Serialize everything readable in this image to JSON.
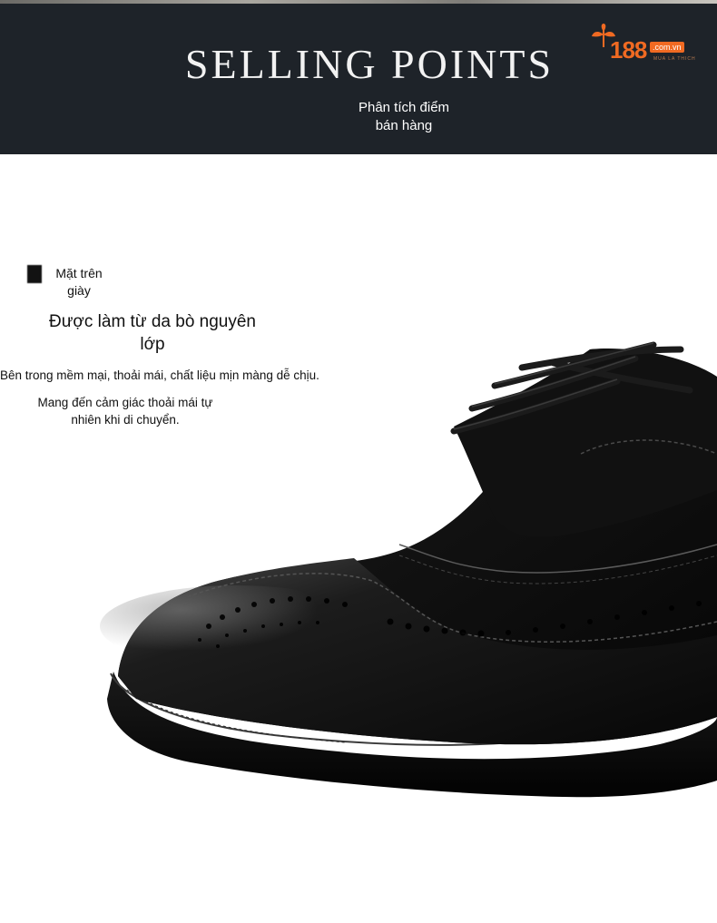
{
  "header": {
    "title": "SELLING POINTS",
    "subtitle": "Phân tích điểm bán hàng"
  },
  "logo": {
    "number": "188",
    "domain": ".com.vn",
    "tagline": "MUA LA THICH"
  },
  "feature": {
    "label": "Mặt trên giày",
    "heading": "Được làm từ da bò nguyên lớp",
    "description_1": "Bên trong mềm mại, thoải mái, chất liệu mịn màng dễ chịu.",
    "description_2": "Mang đến cảm giác thoải mái tự nhiên khi di chuyển."
  },
  "colors": {
    "header_bg": "#1e2329",
    "logo_orange": "#f06a22",
    "shoe_black": "#0d0d0d"
  },
  "image": {
    "subject": "black-leather-brogue-shoe-icon"
  }
}
